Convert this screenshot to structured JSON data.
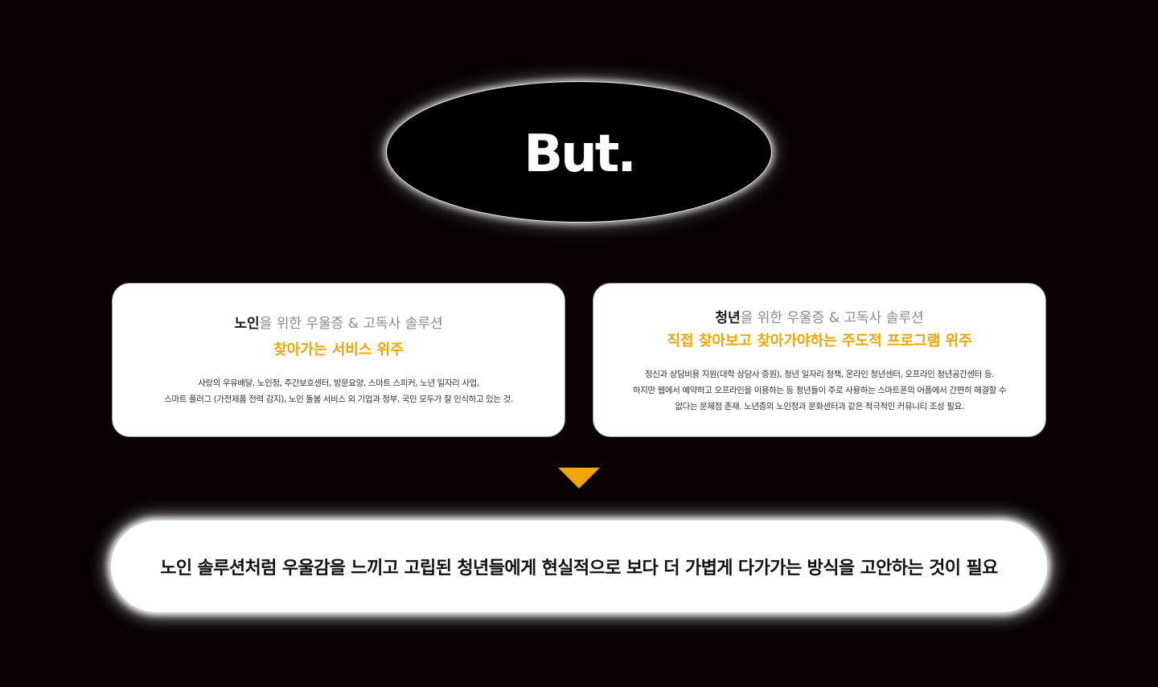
{
  "top": {
    "title": "But."
  },
  "left_card": {
    "heading_em": "노인",
    "heading_rest": "을 위한 우울증 & 고독사 솔루션",
    "highlight": "찾아가는 서비스 위주",
    "body_lines": [
      "사랑의 우유배달, 노인정, 주간보호센터, 방문요양, 스마트 스피커, 노년 일자리 사업,",
      "스마트 플러그 (가전제품 전력 감지), 노인 돌봄 서비스 외 기업과 정부, 국민 모두가 잘 인식하고 있는 것."
    ]
  },
  "right_card": {
    "heading_em": "청년",
    "heading_rest": "을 위한 우울증 & 고독사 솔루션",
    "highlight": "직접 찾아보고 찾아가야하는 주도적 프로그램 위주",
    "body_lines": [
      "정신과 상담비용 지원(대학 상담사 증원), 청년 일자리 정책, 온라인 청년센터, 오프라인 청년공간센터 등.",
      "하지만 웹에서 예약하고 오프라인을 이용하는 등 청년들이 주로 사용하는 스마트폰의 어플에서 간편히 해결할 수",
      "없다는 문제점 존재. 노년층의 노인정과 문화센터과 같은 적극적인 커뮤니티 조성 필요."
    ]
  },
  "conclusion": {
    "text": "노인 솔루션처럼 우울감을 느끼고 고립된 청년들에게 현실적으로 보다 더 가볍게 다가가는 방식을 고안하는 것이 필요"
  },
  "colors": {
    "background": "#080002",
    "accent": "#f0a500",
    "card": "#ffffff"
  },
  "icons": {
    "arrow": "down-triangle-icon"
  }
}
